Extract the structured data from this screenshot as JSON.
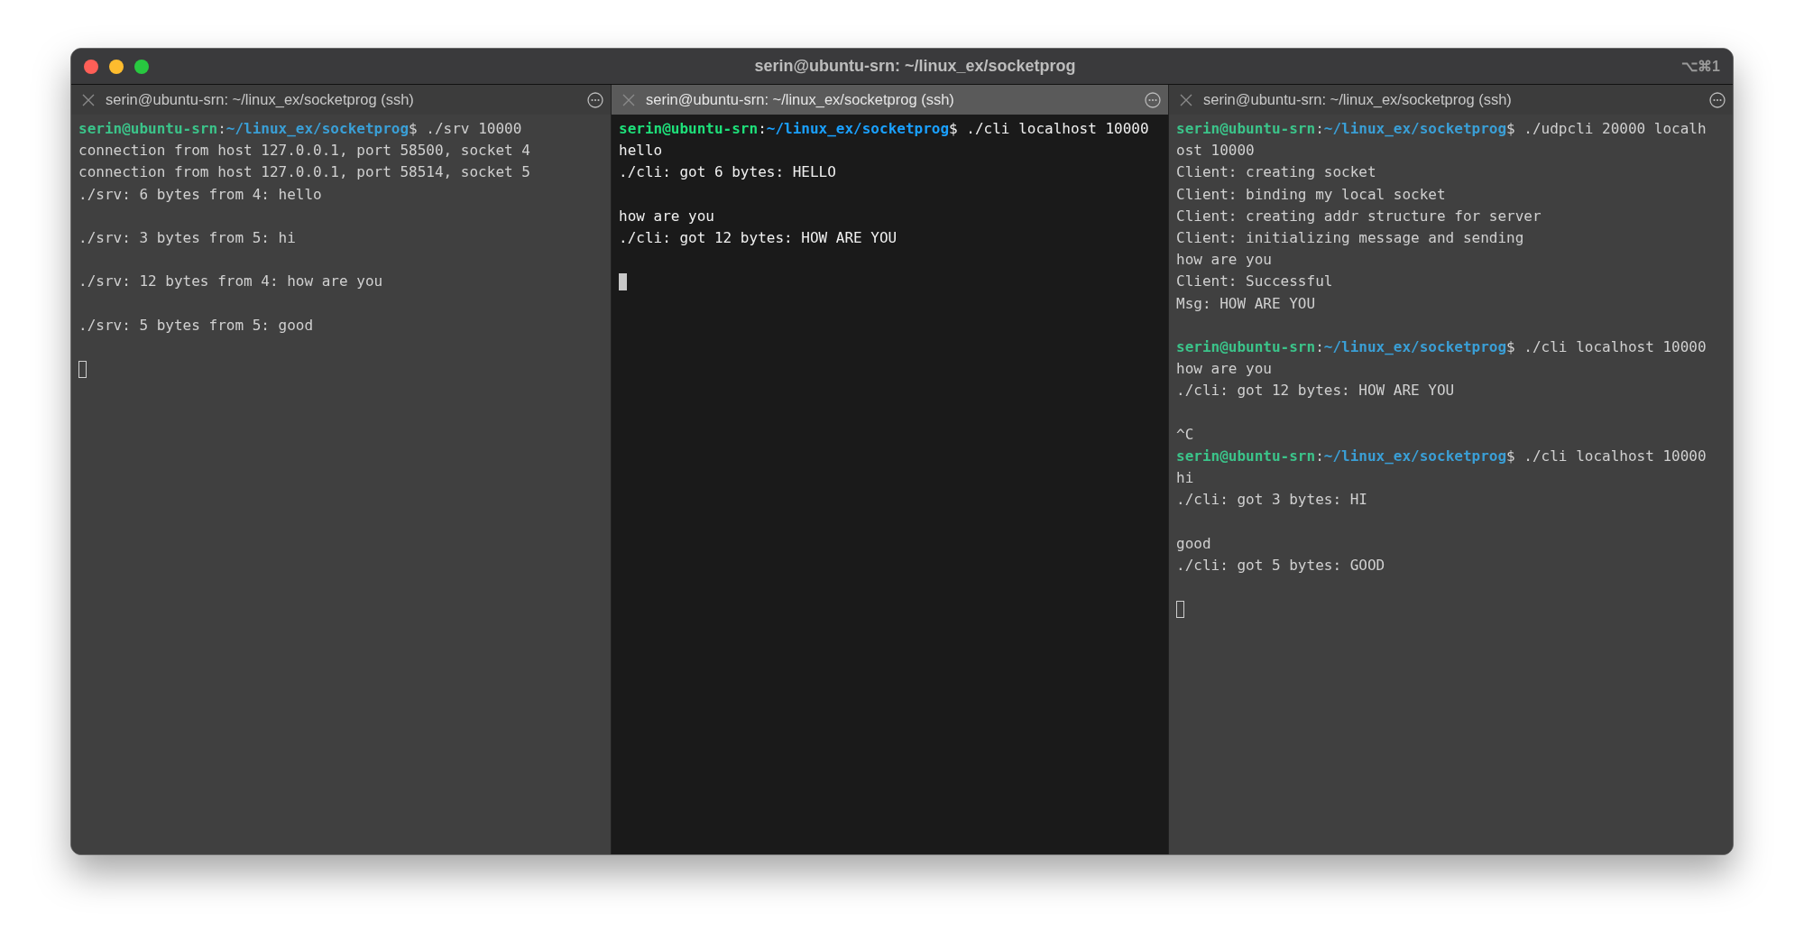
{
  "window": {
    "title": "serin@ubuntu-srn: ~/linux_ex/socketprog",
    "shortcut": "⌥⌘1"
  },
  "panes": [
    {
      "tab_title": "serin@ubuntu-srn: ~/linux_ex/socketprog (ssh)",
      "selected": false,
      "lines": [
        {
          "kind": "prompt",
          "user": "serin@ubuntu-srn",
          "sep": ":",
          "path": "~/linux_ex/socketprog",
          "command": "$ ./srv 10000"
        },
        {
          "kind": "output",
          "text": "connection from host 127.0.0.1, port 58500, socket 4"
        },
        {
          "kind": "output",
          "text": "connection from host 127.0.0.1, port 58514, socket 5"
        },
        {
          "kind": "output",
          "text": "./srv: 6 bytes from 4: hello"
        },
        {
          "kind": "blank"
        },
        {
          "kind": "output",
          "text": "./srv: 3 bytes from 5: hi"
        },
        {
          "kind": "blank"
        },
        {
          "kind": "output",
          "text": "./srv: 12 bytes from 4: how are you"
        },
        {
          "kind": "blank"
        },
        {
          "kind": "output",
          "text": "./srv: 5 bytes from 5: good"
        },
        {
          "kind": "blank"
        },
        {
          "kind": "cursor"
        }
      ]
    },
    {
      "tab_title": "serin@ubuntu-srn: ~/linux_ex/socketprog (ssh)",
      "selected": true,
      "lines": [
        {
          "kind": "prompt",
          "user": "serin@ubuntu-srn",
          "sep": ":",
          "path": "~/linux_ex/socketprog",
          "command": "$ ./cli localhost 10000"
        },
        {
          "kind": "output",
          "text": "hello"
        },
        {
          "kind": "output",
          "text": "./cli: got 6 bytes: HELLO"
        },
        {
          "kind": "blank"
        },
        {
          "kind": "output",
          "text": "how are you"
        },
        {
          "kind": "output",
          "text": "./cli: got 12 bytes: HOW ARE YOU"
        },
        {
          "kind": "blank"
        },
        {
          "kind": "cursor"
        }
      ]
    },
    {
      "tab_title": "serin@ubuntu-srn: ~/linux_ex/socketprog (ssh)",
      "selected": false,
      "lines": [
        {
          "kind": "prompt",
          "user": "serin@ubuntu-srn",
          "sep": ":",
          "path": "~/linux_ex/socketprog",
          "command": "$ ./udpcli 20000 localh"
        },
        {
          "kind": "output",
          "text": "ost 10000"
        },
        {
          "kind": "output",
          "text": "Client: creating socket"
        },
        {
          "kind": "output",
          "text": "Client: binding my local socket"
        },
        {
          "kind": "output",
          "text": "Client: creating addr structure for server"
        },
        {
          "kind": "output",
          "text": "Client: initializing message and sending"
        },
        {
          "kind": "output",
          "text": "how are you"
        },
        {
          "kind": "output",
          "text": "Client: Successful"
        },
        {
          "kind": "output",
          "text": "Msg: HOW ARE YOU"
        },
        {
          "kind": "blank"
        },
        {
          "kind": "prompt",
          "user": "serin@ubuntu-srn",
          "sep": ":",
          "path": "~/linux_ex/socketprog",
          "command": "$ ./cli localhost 10000"
        },
        {
          "kind": "output",
          "text": "how are you"
        },
        {
          "kind": "output",
          "text": "./cli: got 12 bytes: HOW ARE YOU"
        },
        {
          "kind": "blank"
        },
        {
          "kind": "output",
          "text": "^C"
        },
        {
          "kind": "prompt",
          "user": "serin@ubuntu-srn",
          "sep": ":",
          "path": "~/linux_ex/socketprog",
          "command": "$ ./cli localhost 10000"
        },
        {
          "kind": "output",
          "text": "hi"
        },
        {
          "kind": "output",
          "text": "./cli: got 3 bytes: HI"
        },
        {
          "kind": "blank"
        },
        {
          "kind": "output",
          "text": "good"
        },
        {
          "kind": "output",
          "text": "./cli: got 5 bytes: GOOD"
        },
        {
          "kind": "blank"
        },
        {
          "kind": "cursor"
        }
      ]
    }
  ]
}
